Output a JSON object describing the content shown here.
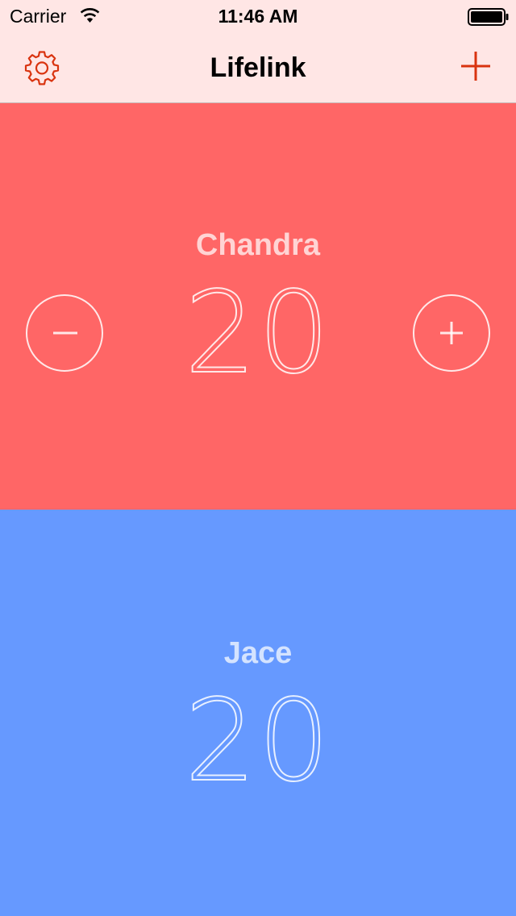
{
  "status_bar": {
    "carrier": "Carrier",
    "time": "11:46 AM",
    "wifi_icon": "wifi-icon",
    "battery_icon": "battery-icon"
  },
  "nav": {
    "title": "Lifelink",
    "left_icon": "gear-icon",
    "right_icon": "plus-icon",
    "accent_color": "#d9330f"
  },
  "players": [
    {
      "name": "Chandra",
      "life": "20",
      "color": "#ff6666",
      "controls": {
        "decrement_icon": "minus-icon",
        "increment_icon": "plus-icon"
      }
    },
    {
      "name": "Jace",
      "life": "20",
      "color": "#6699ff"
    }
  ],
  "colors": {
    "nav_background": "#ffe6e5"
  }
}
